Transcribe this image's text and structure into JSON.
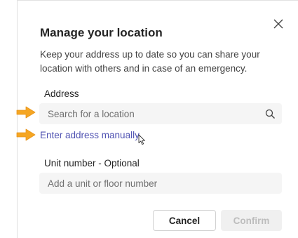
{
  "dialog": {
    "title": "Manage your location",
    "description": "Keep your address up to date so you can share your location with others and in case of an emergency.",
    "close_icon": "close-icon"
  },
  "address": {
    "label": "Address",
    "placeholder": "Search for a location",
    "value": "",
    "search_icon": "search-icon"
  },
  "manual_link": {
    "label": "Enter address manually"
  },
  "unit": {
    "label": "Unit number - Optional",
    "placeholder": "Add a unit or floor number",
    "value": ""
  },
  "buttons": {
    "cancel": "Cancel",
    "confirm": "Confirm"
  },
  "annotations": {
    "arrow_color": "#f5a623",
    "arrow_icon": "arrow-right-icon",
    "cursor_icon": "mouse-pointer-icon"
  },
  "colors": {
    "link": "#4f52b2",
    "input_background": "#f5f5f5",
    "disabled_text": "#bdbdbd"
  }
}
